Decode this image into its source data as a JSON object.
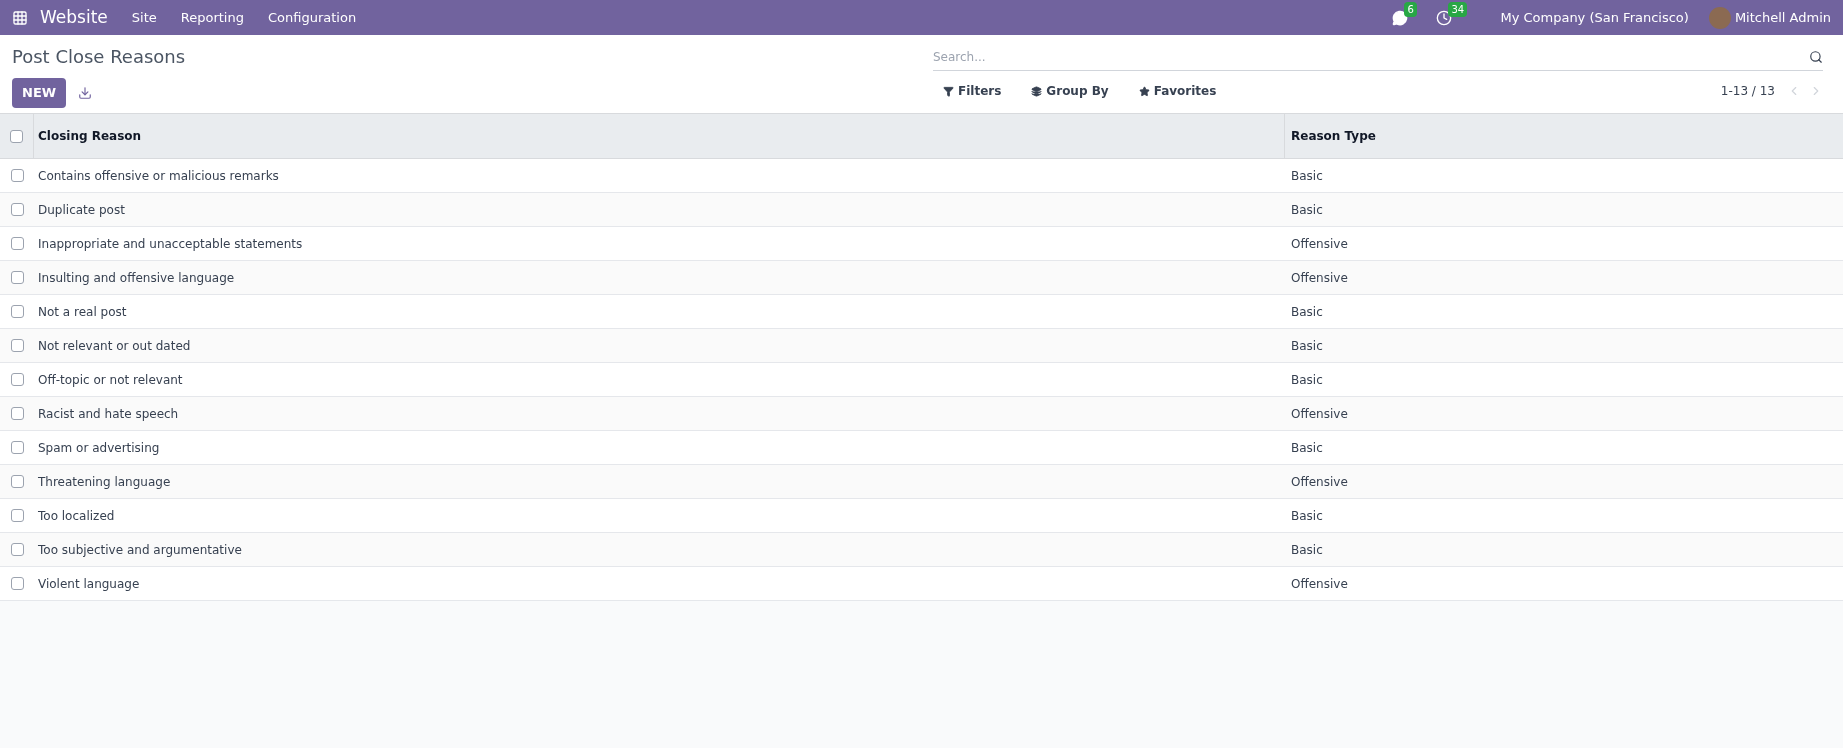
{
  "navbar": {
    "app": "Website",
    "menu": [
      "Site",
      "Reporting",
      "Configuration"
    ],
    "messages_count": "6",
    "activities_count": "34",
    "company": "My Company (San Francisco)",
    "user": "Mitchell Admin"
  },
  "page_title": "Post Close Reasons",
  "new_button": "NEW",
  "search": {
    "placeholder": "Search..."
  },
  "filters": [
    "Filters",
    "Group By",
    "Favorites"
  ],
  "pager": "1-13 / 13",
  "table": {
    "columns": [
      "Closing Reason",
      "Reason Type"
    ],
    "all_checked": false,
    "rows": [
      {
        "reason": "Contains offensive or malicious remarks",
        "type": "Basic",
        "checked": false
      },
      {
        "reason": "Duplicate post",
        "type": "Basic",
        "checked": false
      },
      {
        "reason": "Inappropriate and unacceptable statements",
        "type": "Offensive",
        "checked": false
      },
      {
        "reason": "Insulting and offensive language",
        "type": "Offensive",
        "checked": false
      },
      {
        "reason": "Not a real post",
        "type": "Basic",
        "checked": false
      },
      {
        "reason": "Not relevant or out dated",
        "type": "Basic",
        "checked": false
      },
      {
        "reason": "Off-topic or not relevant",
        "type": "Basic",
        "checked": false
      },
      {
        "reason": "Racist and hate speech",
        "type": "Offensive",
        "checked": false
      },
      {
        "reason": "Spam or advertising",
        "type": "Basic",
        "checked": false
      },
      {
        "reason": "Threatening language",
        "type": "Offensive",
        "checked": false
      },
      {
        "reason": "Too localized",
        "type": "Basic",
        "checked": false
      },
      {
        "reason": "Too subjective and argumentative",
        "type": "Basic",
        "checked": false
      },
      {
        "reason": "Violent language",
        "type": "Offensive",
        "checked": false
      }
    ]
  }
}
